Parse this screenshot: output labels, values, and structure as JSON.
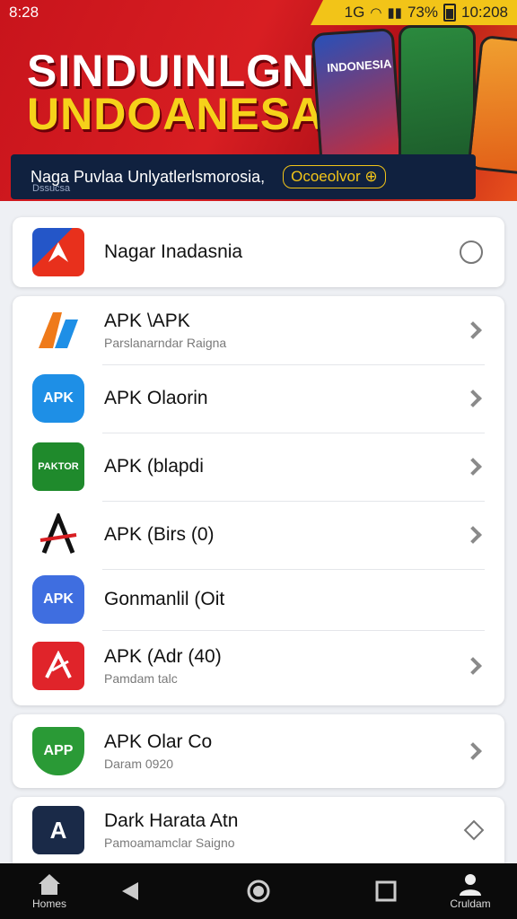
{
  "status_bar": {
    "left": "8:28",
    "network": "1G",
    "battery": "73%",
    "time": "10:208"
  },
  "banner": {
    "headline_line1": "SINDUINLGNN",
    "headline_line2": "UNDOANESAN",
    "phone_label": "INDONESIA",
    "subtitle": "Naga Puvlaa Unlyatlerlsmorosia,",
    "code": "Ocoeolvor ⊕",
    "small_text": "Dssucsa"
  },
  "selected_card": {
    "title": "Nagar Inadasnia"
  },
  "app_list": [
    {
      "icon_text": "A",
      "icon_color": "#ef7a1a",
      "title": "APK \\APK",
      "subtitle": "Parslanarndar Raigna"
    },
    {
      "icon_text": "APK",
      "icon_color": "#1e8fe6",
      "title": "APK Olaorin",
      "subtitle": ""
    },
    {
      "icon_text": "PAKTOR",
      "icon_color": "#1f8a2c",
      "title": "APK (blapdi",
      "subtitle": ""
    },
    {
      "icon_text": "A",
      "icon_color": "#ffffff",
      "title": "APK (Birs (0)",
      "subtitle": ""
    },
    {
      "icon_text": "APK",
      "icon_color": "#3f6ee0",
      "title": "Gonmanlil (Oit",
      "subtitle": ""
    },
    {
      "icon_text": "A",
      "icon_color": "#e0242a",
      "title": "APK (Adr (40)",
      "subtitle": "Pamdam talc"
    }
  ],
  "card_three": {
    "icon_text": "APP",
    "icon_color": "#2a9a36",
    "title": "APK Olar Co",
    "subtitle": "Daram 0920"
  },
  "card_four": {
    "icon_text": "A",
    "icon_color": "#1a2a48",
    "title": "Dark Harata Atn",
    "subtitle": "Pamoamamclar Saigno"
  },
  "nav": {
    "home_label": "Homes",
    "profile_label": "Cruldam"
  }
}
